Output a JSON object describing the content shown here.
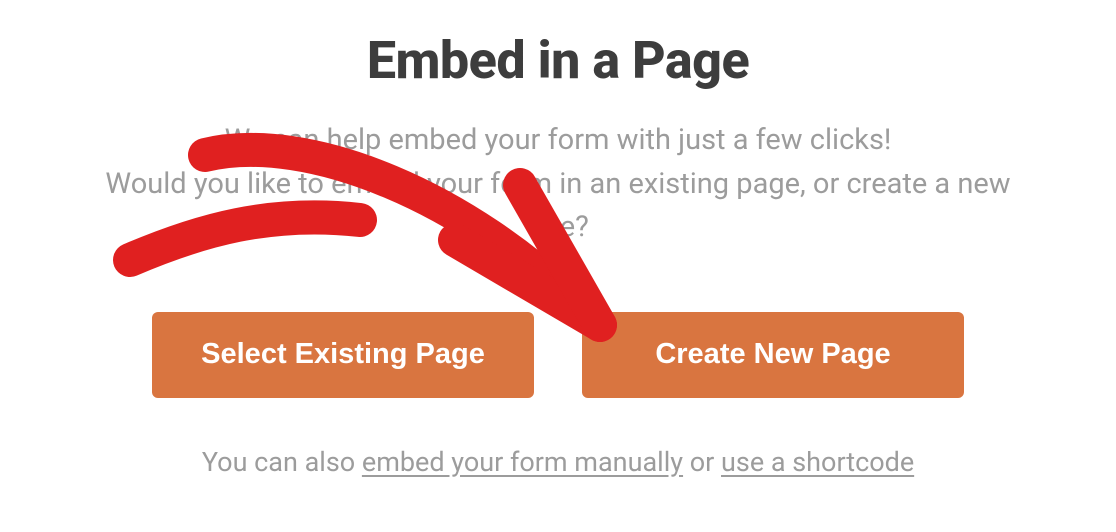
{
  "dialog": {
    "title": "Embed in a Page",
    "description_line1": "We can help embed your form with just a few clicks!",
    "description_line2": "Would you like to embed your form in an existing page, or create a new one?",
    "buttons": {
      "select_existing": "Select Existing Page",
      "create_new": "Create New Page"
    },
    "footer": {
      "prefix": "You can also ",
      "link_manual": "embed your form manually",
      "middle": " or ",
      "link_shortcode": "use a shortcode"
    }
  },
  "annotation": {
    "type": "arrow",
    "color": "#e02020",
    "points_to": "create-new-page-button"
  }
}
